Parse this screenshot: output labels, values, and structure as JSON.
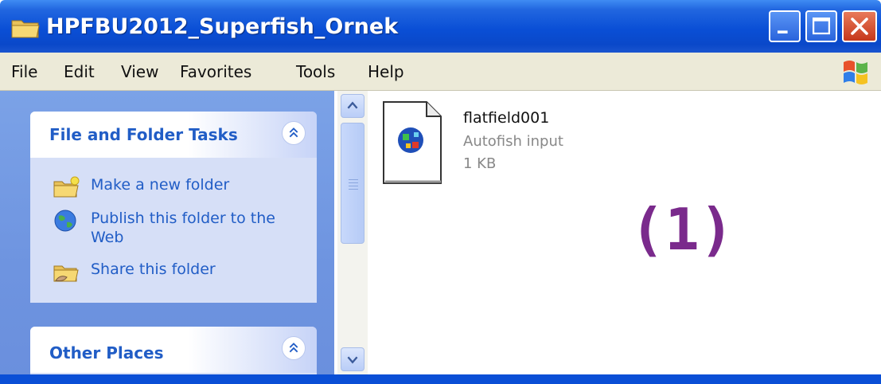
{
  "window": {
    "title": "HPFBU2012_Superfish_Ornek",
    "icon": "folder-icon",
    "controls": [
      "minimize-icon",
      "maximize-icon",
      "close-icon"
    ]
  },
  "menu": {
    "items": [
      {
        "label": "File"
      },
      {
        "label": "Edit"
      },
      {
        "label": "View"
      },
      {
        "label": "Favorites"
      },
      {
        "label": "Tools"
      },
      {
        "label": "Help"
      }
    ],
    "logo": "windows-logo-icon"
  },
  "taskpane": {
    "file_folder_tasks": {
      "title": "File and Folder Tasks",
      "items": [
        {
          "label": "Make a new folder",
          "icon": "new-folder-icon"
        },
        {
          "label": "Publish this folder to the Web",
          "icon": "globe-icon"
        },
        {
          "label": "Share this folder",
          "icon": "share-folder-icon"
        }
      ]
    },
    "other_places": {
      "title": "Other Places"
    }
  },
  "files": [
    {
      "name": "flatfield001",
      "type": "Autofish input",
      "size": "1 KB",
      "icon": "autofish-file-icon"
    }
  ],
  "annotation": "(1)",
  "colors": {
    "titlebar": "#0a4fd6",
    "menubar": "#ecead8",
    "taskpane": "#6e94e0",
    "link": "#215dc6",
    "annotation": "#7a2a8c"
  }
}
